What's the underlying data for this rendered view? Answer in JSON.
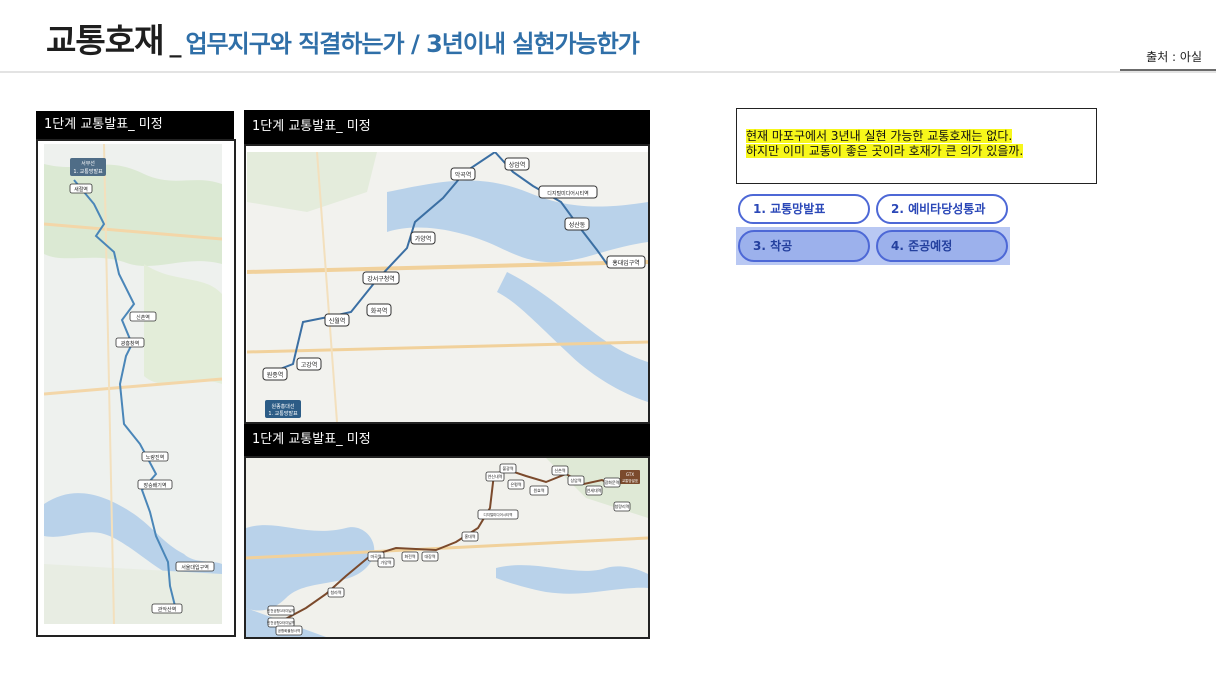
{
  "header": {
    "title_main": "교통호재",
    "title_sep": "_",
    "title_sub": "업무지구와 직결하는가 / 3년이내 실현가능한가",
    "source": "출처 : 아실"
  },
  "panels": {
    "left": {
      "label": "1단계 교통발표_ 미정"
    },
    "top_right": {
      "label": "1단계 교통발표_ 미정"
    },
    "bottom_right": {
      "label": "1단계 교통발표_ 미정"
    }
  },
  "maps": {
    "left": {
      "badge_lines": [
        "서부선",
        "1. 교통망발표"
      ],
      "stations": [
        "새절역",
        "신촌역",
        "광흥창역",
        "노량진역",
        "장승배기역",
        "서울대입구역",
        "관악산역"
      ]
    },
    "top_right": {
      "badge_lines": [
        "원종홍대선",
        "1. 교통망발표"
      ],
      "stations": [
        "원종역",
        "고강역",
        "신월역",
        "화곡역",
        "강서구청역",
        "가양역",
        "악곡역",
        "상암역",
        "디지털미디어시티역",
        "성산동",
        "홍대입구역"
      ]
    },
    "bottom_right": {
      "badge_lines": [
        "GTX",
        "교통망발표"
      ],
      "stations": [
        "인천공항1터미널역",
        "인천공항2터미널역",
        "공항화물청사역",
        "청라역",
        "마곡역",
        "가양역",
        "화전역",
        "대장역",
        "디지털미디어시티역",
        "홍대역",
        "은평역",
        "연신내역",
        "불광역",
        "신촌역",
        "원효역",
        "상암역",
        "연세대역",
        "광화문역",
        "청량리역"
      ]
    }
  },
  "info": {
    "line1": "현재 마포구에서 3년내 실현 가능한 교통호재는 없다.",
    "line2": "하지만 이미 교통이 좋은 곳이라 호재가 큰 의가 있을까."
  },
  "steps": [
    {
      "label": "1. 교통망발표"
    },
    {
      "label": "2. 예비타당성통과"
    },
    {
      "label": "3. 착공"
    },
    {
      "label": "4. 준공예정"
    }
  ],
  "colors": {
    "accent_blue": "#2f6fa8",
    "route_blue": "#4a86b8",
    "route_brown": "#7b4a2c",
    "highlight_yellow": "#f7f71a",
    "step_border": "#4d68d6",
    "step_fill_active": "#9cb1ec"
  }
}
